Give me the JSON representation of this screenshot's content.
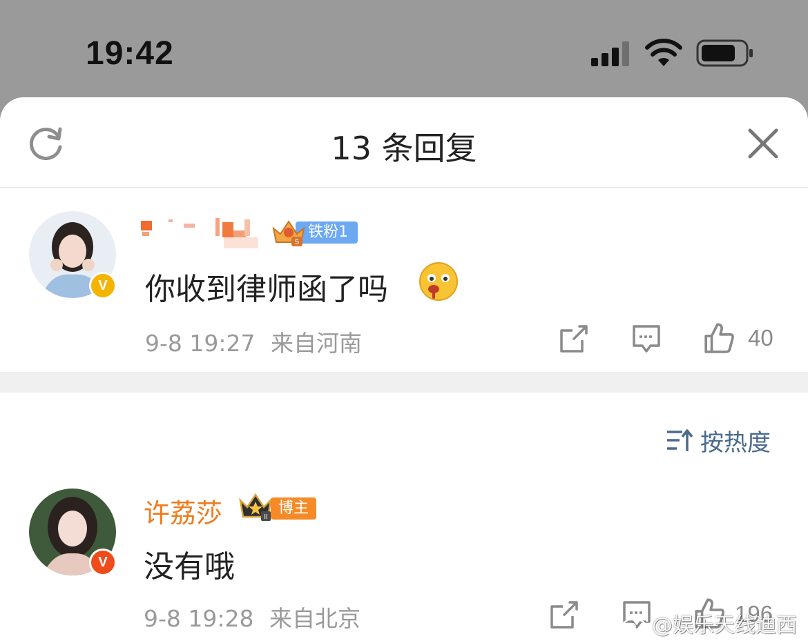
{
  "status_bar": {
    "time": "19:42"
  },
  "sheet": {
    "title": "13 条回复",
    "refresh_icon": "refresh-icon",
    "close_icon": "close-icon"
  },
  "original_comment": {
    "username": "",
    "fan_badge": "铁粉1",
    "text": "你收到律师函了吗",
    "emoji": "drooling-face-emoji",
    "time": "9-8 19:27",
    "location": "来自河南",
    "like_count": "40",
    "verify_color": "#f5b400"
  },
  "sort": {
    "label": "按热度"
  },
  "reply": {
    "username": "许荔莎",
    "badge": "博主",
    "text": "没有哦",
    "time": "9-8 19:28",
    "location": "来自北京",
    "like_count": "196",
    "verify_color": "#f04b1b"
  },
  "watermark": {
    "text": "@娱乐天线迪西"
  },
  "colors": {
    "accent_orange": "#ef7b1e",
    "fan_blue": "#6da8f2",
    "sort_blue": "#4a6a8c"
  }
}
